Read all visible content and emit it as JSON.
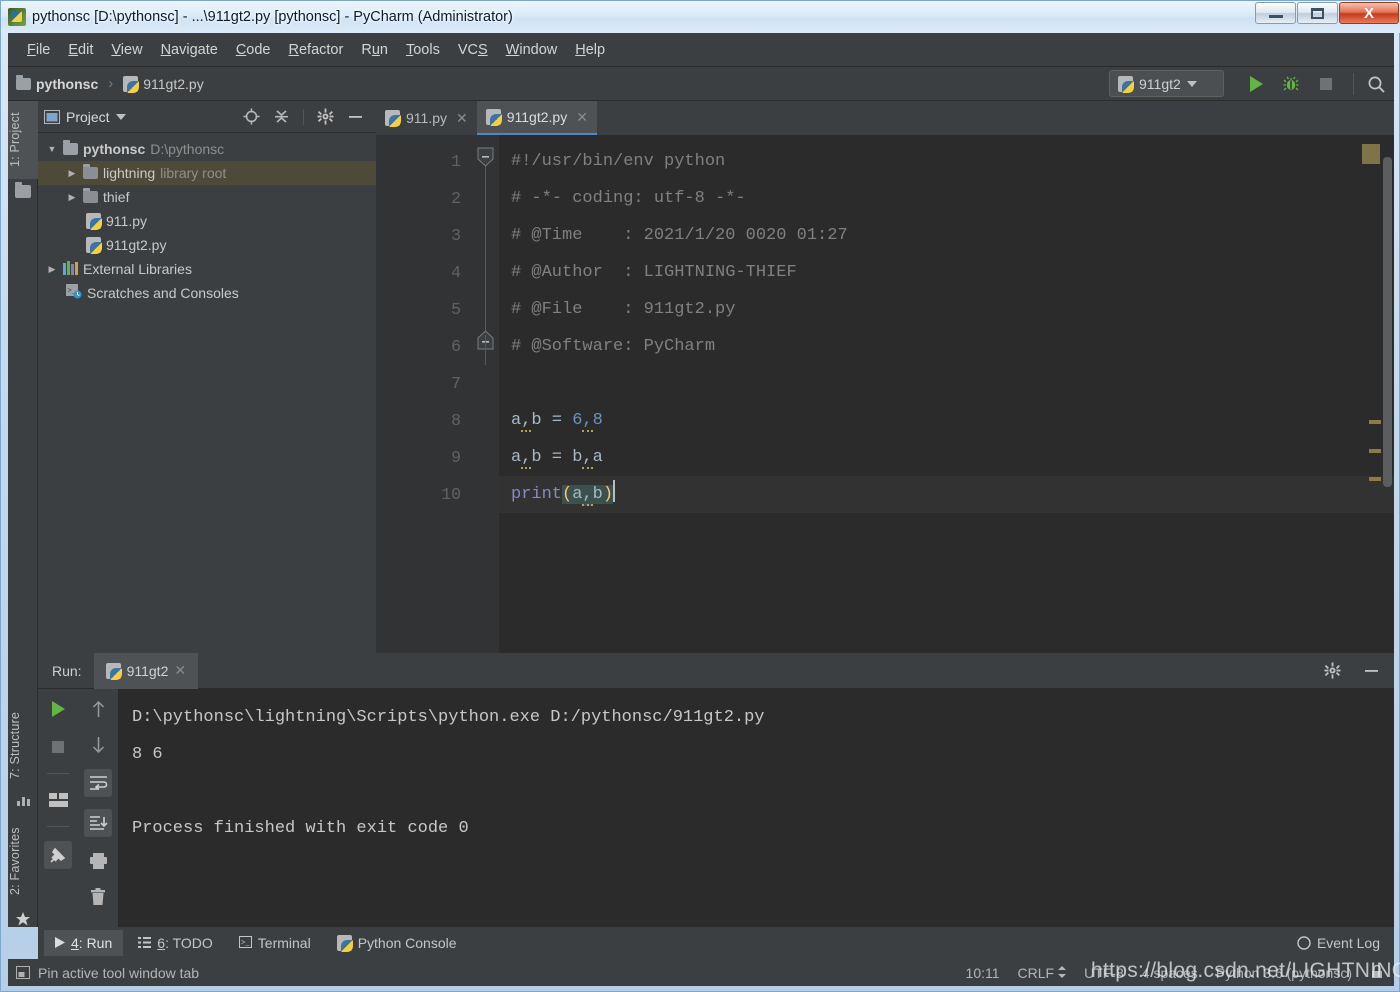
{
  "window": {
    "title": "pythonsc [D:\\pythonsc] - ...\\911gt2.py [pythonsc] - PyCharm (Administrator)",
    "minimize_label": "Minimize",
    "maximize_label": "Maximize",
    "close_label": "X"
  },
  "menubar": {
    "items": [
      {
        "label": "File",
        "mnemonic": "F"
      },
      {
        "label": "Edit",
        "mnemonic": "E"
      },
      {
        "label": "View",
        "mnemonic": "V"
      },
      {
        "label": "Navigate",
        "mnemonic": "N"
      },
      {
        "label": "Code",
        "mnemonic": "C"
      },
      {
        "label": "Refactor",
        "mnemonic": "R"
      },
      {
        "label": "Run",
        "mnemonic": "u"
      },
      {
        "label": "Tools",
        "mnemonic": "T"
      },
      {
        "label": "VCS",
        "mnemonic": "S"
      },
      {
        "label": "Window",
        "mnemonic": "W"
      },
      {
        "label": "Help",
        "mnemonic": "H"
      }
    ]
  },
  "navbar": {
    "crumbs": [
      "pythonsc",
      "911gt2.py"
    ],
    "separator": "›",
    "run_config": "911gt2",
    "run_label": "Run",
    "debug_label": "Debug",
    "stop_label": "Stop",
    "search_label": "Search everywhere"
  },
  "left_strip": {
    "tabs": [
      {
        "label": "1: Project",
        "active": true
      },
      {
        "label": "7: Structure",
        "active": false
      },
      {
        "label": "2: Favorites",
        "active": false
      }
    ]
  },
  "project_panel": {
    "title": "Project",
    "tree": [
      {
        "indent": 0,
        "arrow": "▼",
        "icon": "folder-icon",
        "label": "pythonsc",
        "hint": "D:\\pythonsc",
        "bold": true,
        "selected": false
      },
      {
        "indent": 1,
        "arrow": "▶",
        "icon": "folder-icon",
        "label": "lightning",
        "hint": "library root",
        "bold": false,
        "selected": true
      },
      {
        "indent": 1,
        "arrow": "▶",
        "icon": "folder-icon",
        "label": "thief",
        "hint": "",
        "bold": false,
        "selected": false
      },
      {
        "indent": 2,
        "arrow": "",
        "icon": "python-file-icon",
        "label": "911.py",
        "hint": "",
        "bold": false,
        "selected": false
      },
      {
        "indent": 2,
        "arrow": "",
        "icon": "python-file-icon",
        "label": "911gt2.py",
        "hint": "",
        "bold": false,
        "selected": false
      },
      {
        "indent": 0,
        "arrow": "▶",
        "icon": "libraries-icon",
        "label": "External Libraries",
        "hint": "",
        "bold": false,
        "selected": false
      },
      {
        "indent": 0,
        "arrow": "",
        "icon": "scratches-icon",
        "label": "Scratches and Consoles",
        "hint": "",
        "bold": false,
        "selected": false
      }
    ]
  },
  "editor": {
    "tabs": [
      {
        "label": "911.py",
        "active": false
      },
      {
        "label": "911gt2.py",
        "active": true
      }
    ],
    "lines": [
      {
        "no": "1",
        "text": "#!/usr/bin/env python",
        "kind": "comment",
        "fold": "start"
      },
      {
        "no": "2",
        "text": "# -*- coding: utf-8 -*-",
        "kind": "comment",
        "fold": ""
      },
      {
        "no": "3",
        "text": "# @Time    : 2021/1/20 0020 01:27",
        "kind": "comment",
        "fold": ""
      },
      {
        "no": "4",
        "text": "# @Author  : LIGHTNING-THIEF",
        "kind": "comment",
        "fold": ""
      },
      {
        "no": "5",
        "text": "# @File    : 911gt2.py",
        "kind": "comment",
        "fold": ""
      },
      {
        "no": "6",
        "text": "# @Software: PyCharm",
        "kind": "comment",
        "fold": "end"
      },
      {
        "no": "7",
        "text": "",
        "kind": "blank",
        "fold": ""
      },
      {
        "no": "8",
        "text": "a,b = 6,8",
        "kind": "code",
        "fold": ""
      },
      {
        "no": "9",
        "text": "a,b = b,a",
        "kind": "code",
        "fold": ""
      },
      {
        "no": "10",
        "text": "print(a,b)",
        "kind": "code",
        "fold": ""
      }
    ]
  },
  "run_panel": {
    "label": "Run:",
    "tab": "911gt2",
    "settings_label": "Settings",
    "hide_label": "Hide",
    "toolbar_left": [
      "rerun-icon",
      "stop-icon",
      "layout-icon",
      "pin-icon"
    ],
    "toolbar_right": [
      "arrow-up-icon",
      "arrow-down-icon",
      "soft-wrap-icon",
      "scroll-to-end-icon",
      "print-icon",
      "trash-icon"
    ],
    "console": [
      "D:\\pythonsc\\lightning\\Scripts\\python.exe D:/pythonsc/911gt2.py",
      "8 6",
      "",
      "Process finished with exit code 0"
    ]
  },
  "bottom_tabs": {
    "items": [
      {
        "label": "4: Run",
        "mnemonic": "4",
        "icon": "play-icon",
        "active": true
      },
      {
        "label": "6: TODO",
        "mnemonic": "6",
        "icon": "list-icon",
        "active": false
      },
      {
        "label": "Terminal",
        "mnemonic": "",
        "icon": "terminal-icon",
        "active": false
      },
      {
        "label": "Python Console",
        "mnemonic": "",
        "icon": "python-icon",
        "active": false
      }
    ],
    "event_log": "Event Log"
  },
  "status_bar": {
    "pin_text": "Pin active tool window tab",
    "caret": "10:11",
    "line_sep": "CRLF",
    "encoding": "UTF-8",
    "indent": "4 spaces",
    "interpreter": "Python 3.6 (pythonsc)",
    "lock_icon": "lock-icon"
  },
  "watermark": "https://blog.csdn.net/LIGHTNING_THIEF",
  "colors": {
    "chrome": "#3c3f41",
    "editor_bg": "#2b2b2b",
    "gutter_bg": "#313335",
    "accent": "#4a88c7",
    "run_green": "#62b543",
    "selection": "#4e4a39",
    "comment": "#808080",
    "keyword": "#8888c6",
    "number": "#6897bb",
    "identifier": "#a9b7c6",
    "brace_match": "#ffc66d"
  }
}
